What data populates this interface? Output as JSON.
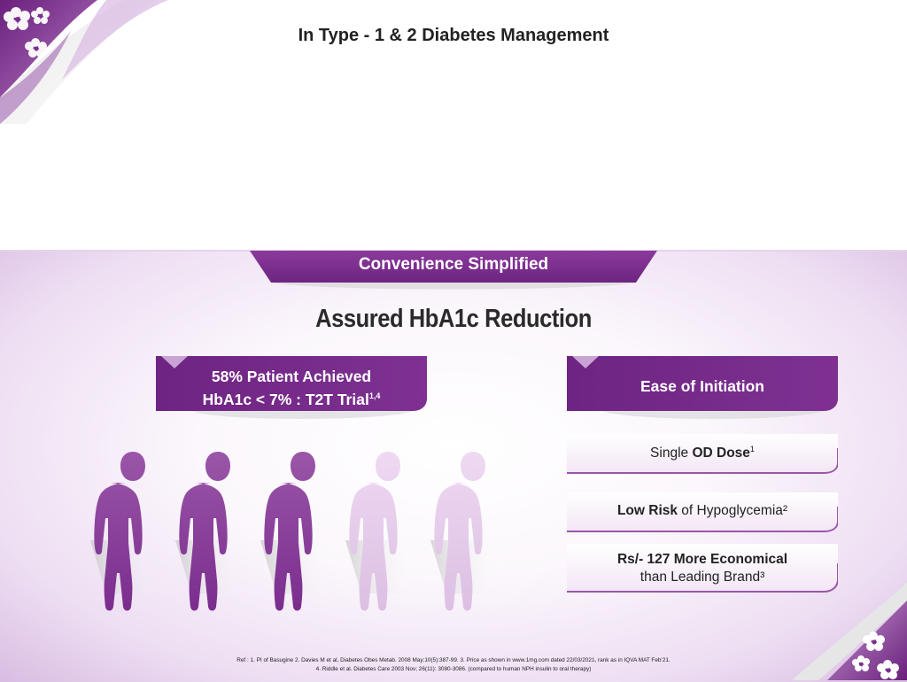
{
  "page": {
    "title": "In Type - 1 & 2 Diabetes Management"
  },
  "ribbon": {
    "label": "Convenience  Simplified"
  },
  "headline": "Assured HbA1c Reduction",
  "left_banner": {
    "line1": "58% Patient Achieved",
    "line2": "HbA1c  < 7% : T2T Trial",
    "superscript": "1,4"
  },
  "people_chart": {
    "total_figures": 5,
    "highlighted_figures": 3,
    "highlight_color": "#8e3f9b",
    "faded_color": "#e6c9ea"
  },
  "right_banner": {
    "label": "Ease of Initiation"
  },
  "features": [
    {
      "prefix": "Single ",
      "bold": "OD Dose",
      "suffix": "",
      "superscript": "1"
    },
    {
      "prefix": "",
      "bold": "Low Risk",
      "suffix": " of Hypoglycemia²",
      "superscript": ""
    },
    {
      "prefix": "",
      "bold": "Rs/- 127 More Economical",
      "suffix": "",
      "line2": "than Leading Brand³"
    }
  ],
  "footer": {
    "line1": "Ref :  1. PI of Basugine       2. Davies M et al, Diabetes Obes Metab. 2008 May;10(5):387-99.       3.  Price as shown in www.1mg.com dated 22/03/2021, rank as in IQVA MAT Feb’21.",
    "line2": "4. Riddle et al. Diabetes Care 2003 Nov; 26(11): 3080-3086. (compared to  human NPH insulin to oral therapy)"
  },
  "colors": {
    "brand_purple": "#7b2d8e",
    "light_purple": "#e6c9ea"
  }
}
